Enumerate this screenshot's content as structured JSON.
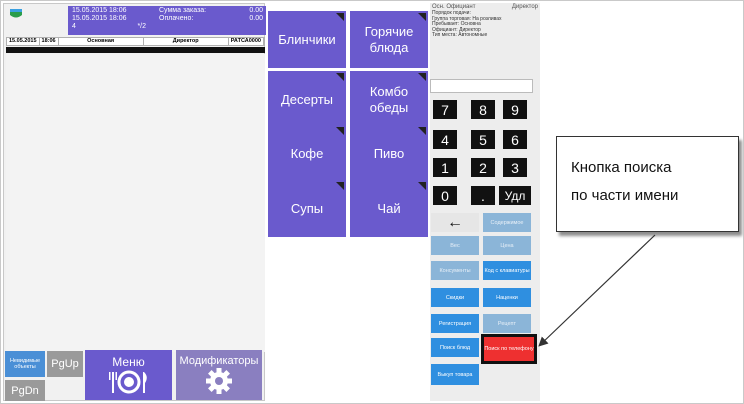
{
  "header": {
    "date1": "15.05.2015 18:06",
    "date2": "15.05.2015 18:06",
    "guests": "4",
    "table": "*/2",
    "order_sum_label": "Сумма заказа:",
    "order_sum_value": "0.00",
    "paid_label": "Оплачено:",
    "paid_value": "0.00"
  },
  "info_row": {
    "date": "15.05.2015",
    "time": "18:06",
    "section": "Основная",
    "role": "Директор",
    "code": "РАТСА0000"
  },
  "left_buttons": {
    "unknown_objects": "Невидимые объекты",
    "pgup": "PgUp",
    "pgdn": "PgDn",
    "menu": "Меню",
    "modifiers": "Модификаторы"
  },
  "categories": [
    {
      "label": "Блинчики"
    },
    {
      "label": "Горячие блюда"
    },
    {
      "label": "Десерты"
    },
    {
      "label": "Комбо обеды"
    },
    {
      "label": "Кофе"
    },
    {
      "label": "Пиво"
    },
    {
      "label": "Супы"
    },
    {
      "label": "Чай"
    }
  ],
  "employee": {
    "place": "Осн. Официант",
    "role": "Директор",
    "lines": [
      "Порядок подачи:",
      "Группа торговая: На розливах",
      "Пребывает: Основна",
      "Официант: Директор",
      "Тип места: Автономные"
    ]
  },
  "keypad": [
    "7",
    "8",
    "9",
    "4",
    "5",
    "6",
    "1",
    "2",
    "3",
    "0",
    ".",
    "Удл"
  ],
  "functions": {
    "back": "←",
    "contents": "Содержимое",
    "weight": "Вес",
    "price": "Цена",
    "consumables": "Консументы",
    "keyboard_code": "Код с клавиатуры",
    "discounts": "Скидки",
    "markups": "Наценки",
    "registration": "Регистрация",
    "recipe": "Рецепт",
    "dish_search": "Поиск блюд",
    "phone_search": "Поиск по телефону",
    "buyout": "Выкуп товара"
  },
  "callout": {
    "line1": "Кнопка поиска",
    "line2": "по части имени"
  },
  "colors": {
    "accent": "#6a5acd",
    "function_blue": "#2f8fe0",
    "alert_red": "#ee3030"
  }
}
